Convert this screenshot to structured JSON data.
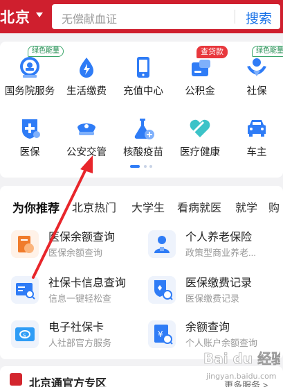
{
  "header": {
    "city": "北京",
    "search_placeholder": "无偿献血证",
    "search_button": "搜索",
    "bg_color": "#cf1f2e"
  },
  "services": [
    {
      "label": "国务院服务",
      "icon": "state-council-icon",
      "tag": "绿色能量",
      "tag_type": "green"
    },
    {
      "label": "生活缴费",
      "icon": "utility-payment-icon",
      "tag": "",
      "tag_type": ""
    },
    {
      "label": "充值中心",
      "icon": "phone-recharge-icon",
      "tag": "",
      "tag_type": ""
    },
    {
      "label": "公积金",
      "icon": "housing-fund-icon",
      "tag": "查贷款",
      "tag_type": "red"
    },
    {
      "label": "社保",
      "icon": "social-security-icon",
      "tag": "绿色能量",
      "tag_type": "green"
    },
    {
      "label": "医保",
      "icon": "medical-insurance-icon",
      "tag": "",
      "tag_type": ""
    },
    {
      "label": "公安交管",
      "icon": "traffic-police-icon",
      "tag": "",
      "tag_type": ""
    },
    {
      "label": "核酸疫苗",
      "icon": "nucleic-vaccine-icon",
      "tag": "",
      "tag_type": ""
    },
    {
      "label": "医疗健康",
      "icon": "health-heart-icon",
      "tag": "",
      "tag_type": ""
    },
    {
      "label": "车主",
      "icon": "car-owner-icon",
      "tag": "",
      "tag_type": ""
    }
  ],
  "recommend": {
    "tabs": [
      "为你推荐",
      "北京热门",
      "大学生",
      "看病就医",
      "就学",
      "购"
    ],
    "items": [
      {
        "title": "医保余额查询",
        "subtitle": "医保余额查询",
        "icon": "medical-balance-icon"
      },
      {
        "title": "个人养老保险",
        "subtitle": "政策型商业养老...",
        "icon": "pension-icon"
      },
      {
        "title": "社保卡信息查询",
        "subtitle": "信息一键轻松查",
        "icon": "social-card-search-icon"
      },
      {
        "title": "医保缴费记录",
        "subtitle": "医保缴费记录",
        "icon": "payment-record-icon"
      },
      {
        "title": "电子社保卡",
        "subtitle": "人社部官方服务",
        "icon": "e-social-card-icon"
      },
      {
        "title": "余额查询",
        "subtitle": "个人账户余额查询",
        "icon": "balance-query-icon"
      }
    ]
  },
  "bottom": {
    "title": "北京通官方专区",
    "more": "更多服务 >"
  },
  "watermark": {
    "brand": "Bai du 经验",
    "url": "jingyan.baidu.com"
  },
  "colors": {
    "accent": "#2f7cf6",
    "annotation_arrow": "#e8262b"
  }
}
